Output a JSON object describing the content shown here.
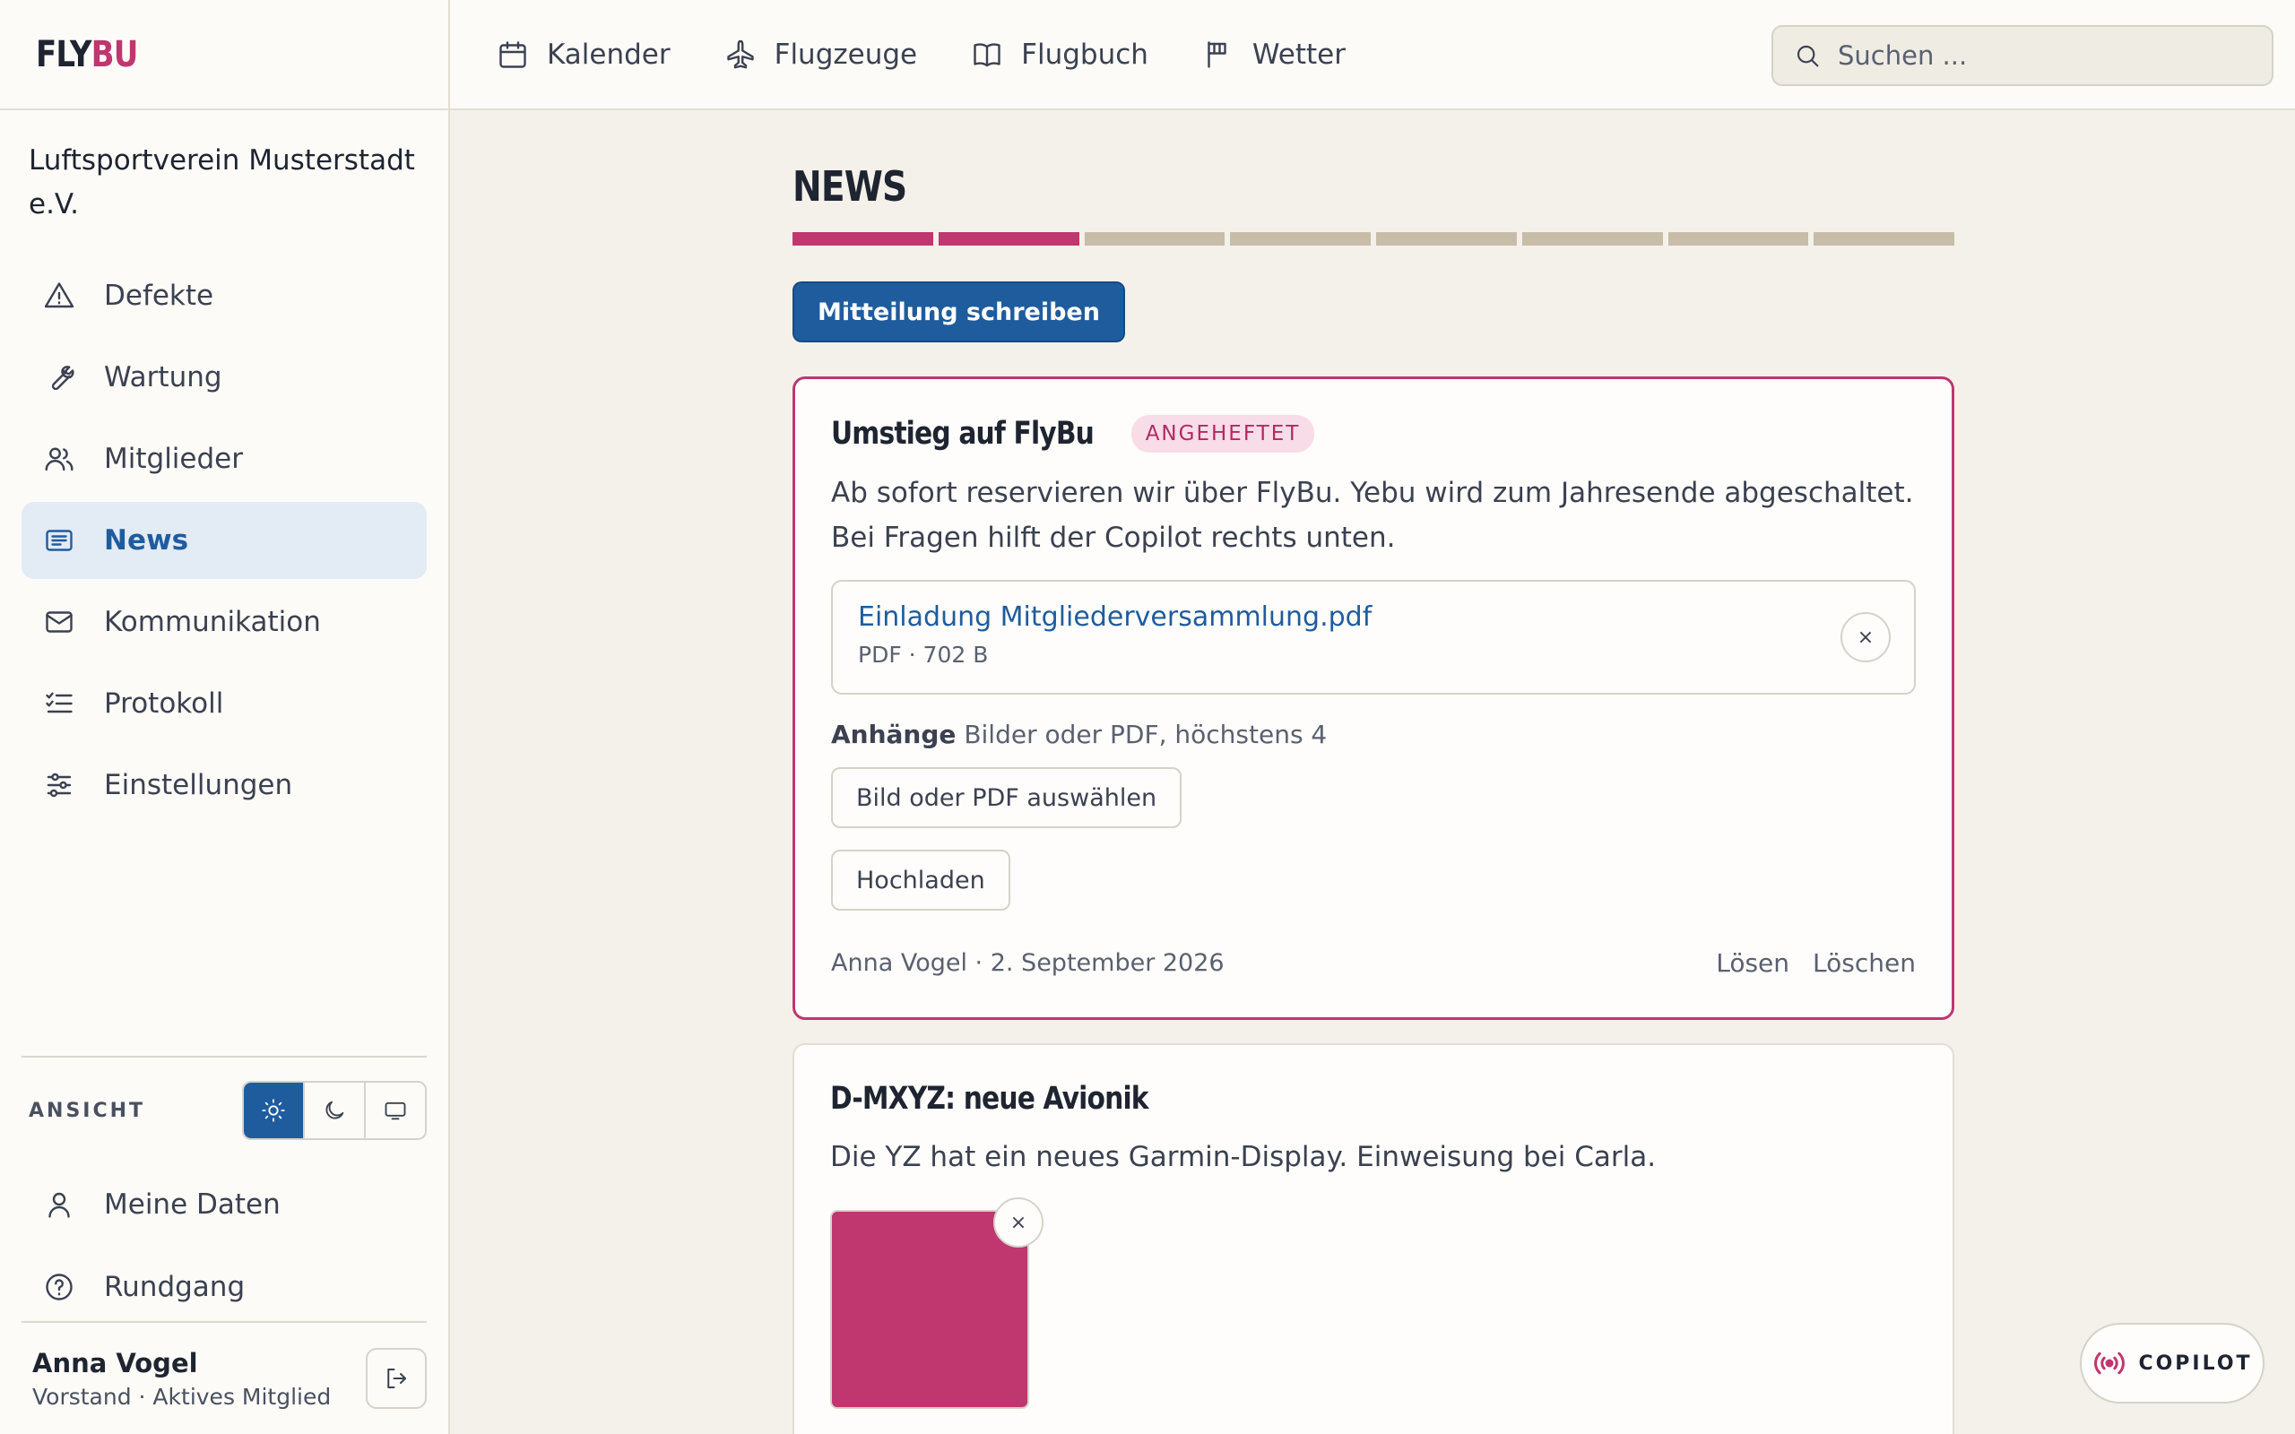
{
  "brand": {
    "part1": "FLY",
    "part2": "BU",
    "accent": "#c0366f",
    "primary": "#1f5c9e"
  },
  "club": "Luftsportverein Musterstadt e.V.",
  "sidebar": {
    "items": [
      {
        "label": "Defekte",
        "icon": "warning-icon"
      },
      {
        "label": "Wartung",
        "icon": "wrench-icon"
      },
      {
        "label": "Mitglieder",
        "icon": "users-icon"
      },
      {
        "label": "News",
        "icon": "news-icon"
      },
      {
        "label": "Kommunikation",
        "icon": "mail-icon"
      },
      {
        "label": "Protokoll",
        "icon": "list-icon"
      },
      {
        "label": "Einstellungen",
        "icon": "sliders-icon"
      }
    ],
    "active": "News",
    "view_label": "ANSICHT",
    "theme_options": [
      "light",
      "dark",
      "system"
    ],
    "theme_selected": "light",
    "my_data": "Meine Daten",
    "tour": "Rundgang"
  },
  "user": {
    "name": "Anna Vogel",
    "role": "Vorstand · Aktives Mitglied"
  },
  "topnav": [
    {
      "label": "Kalender",
      "icon": "calendar-icon"
    },
    {
      "label": "Flugzeuge",
      "icon": "plane-icon"
    },
    {
      "label": "Flugbuch",
      "icon": "book-icon"
    },
    {
      "label": "Wetter",
      "icon": "flag-icon"
    }
  ],
  "search": {
    "placeholder": "Suchen ..."
  },
  "page": {
    "title": "NEWS",
    "progress": {
      "total": 8,
      "done": 2
    },
    "write_button": "Mitteilung schreiben"
  },
  "posts": [
    {
      "title": "Umstieg auf FlyBu",
      "badge": "ANGEHEFTET",
      "body": "Ab sofort reservieren wir über FlyBu. Yebu wird zum Jahresende abgeschaltet. Bei Fragen hilft der Copilot rechts unten.",
      "attachment": {
        "name": "Einladung Mitgliederversammlung.pdf",
        "meta": "PDF · 702 B"
      },
      "attach_label": "Anhänge",
      "attach_hint": "Bilder oder PDF, höchstens 4",
      "choose_button": "Bild oder PDF auswählen",
      "upload_button": "Hochladen",
      "author": "Anna Vogel · 2. September 2026",
      "unpin": "Lösen",
      "delete": "Löschen"
    },
    {
      "title": "D-MXYZ: neue Avionik",
      "body": "Die YZ hat ein neues Garmin-Display. Einweisung bei Carla.",
      "image_color": "#c0366f"
    }
  ],
  "remove_symbol": "×",
  "copilot": {
    "label": "COPILOT"
  }
}
